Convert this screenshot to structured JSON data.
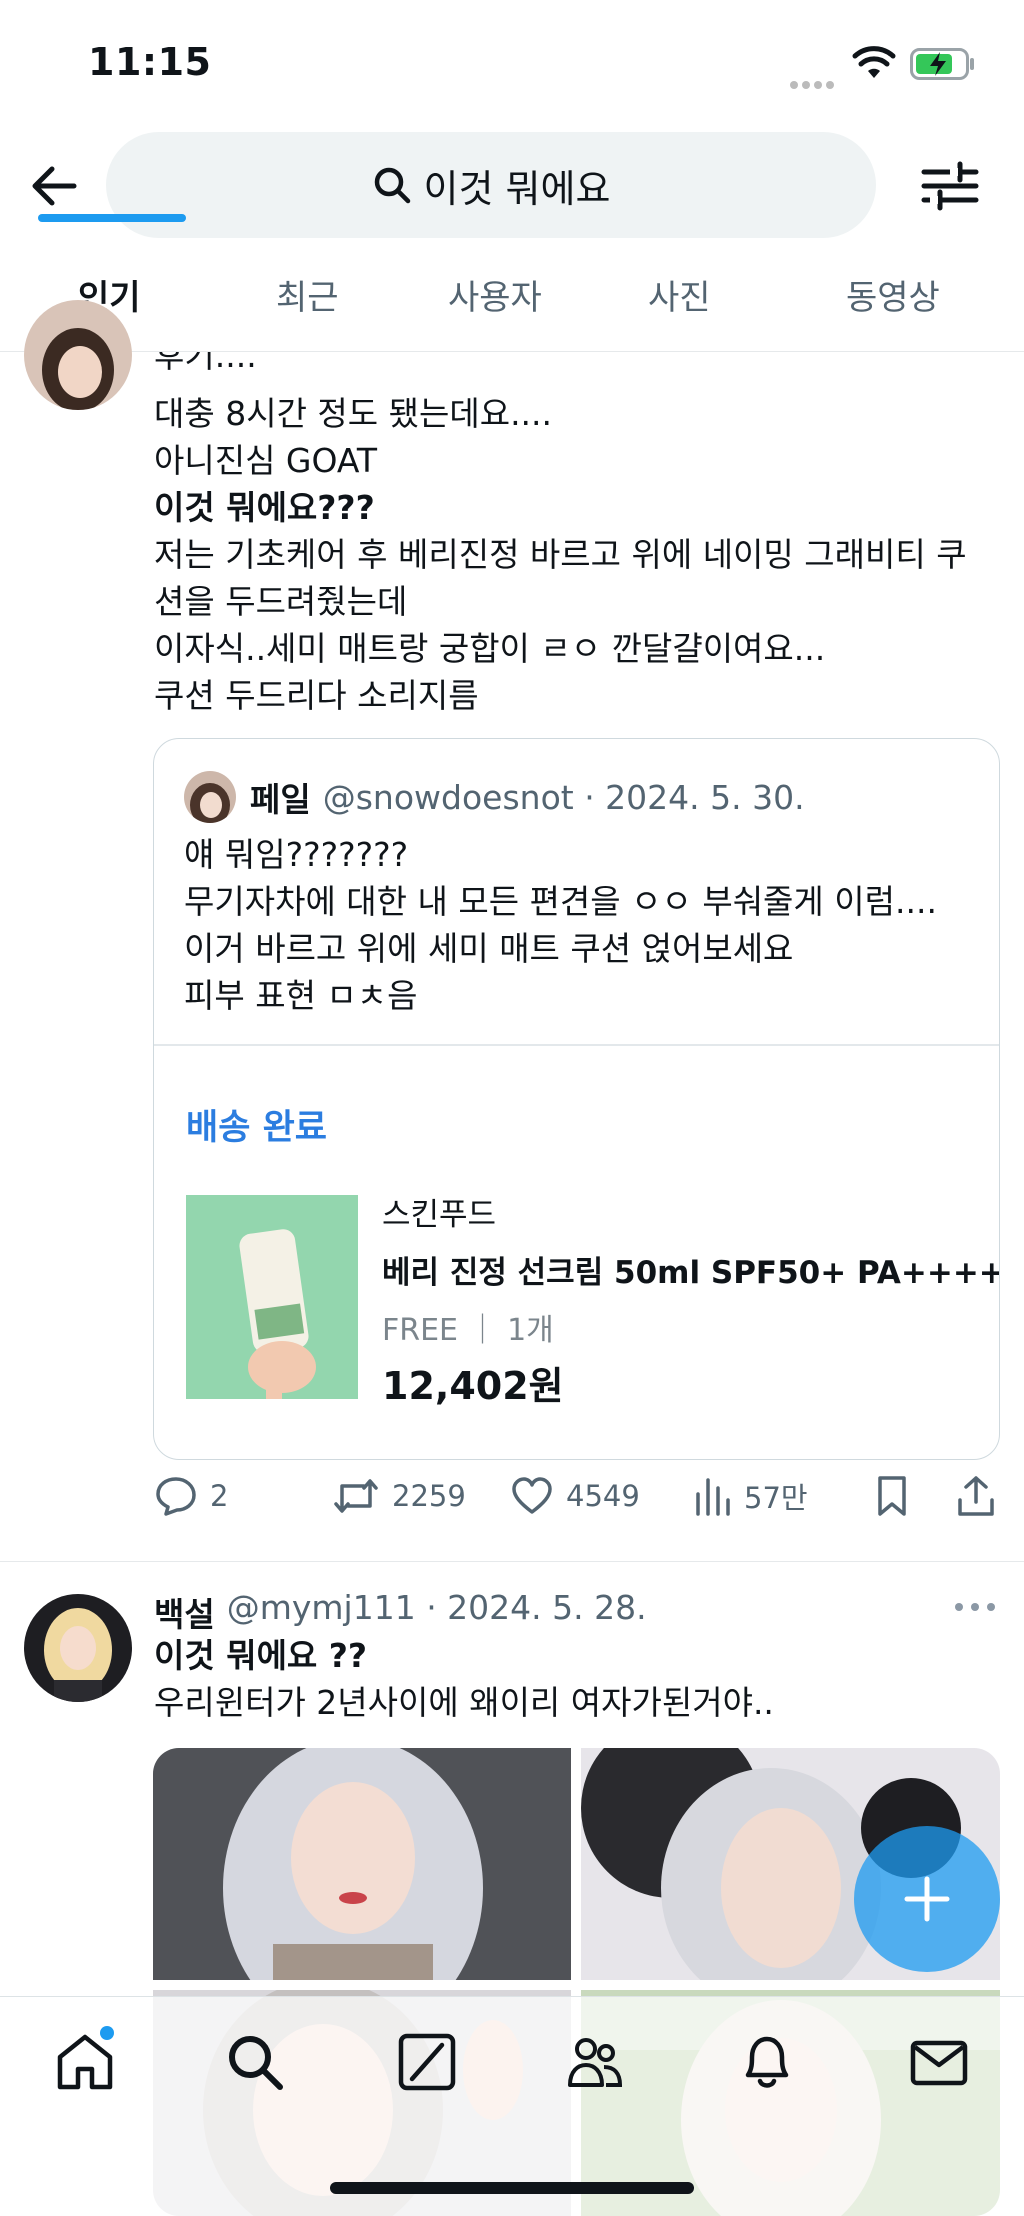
{
  "status_bar": {
    "time": "11:15"
  },
  "search": {
    "query": "이것 뭐에요"
  },
  "tabs": [
    {
      "label": "인기",
      "active": true
    },
    {
      "label": "최근",
      "active": false
    },
    {
      "label": "사용자",
      "active": false
    },
    {
      "label": "사진",
      "active": false
    },
    {
      "label": "동영상",
      "active": false
    }
  ],
  "post1": {
    "lines": [
      "후기....",
      "대충 8시간 정도 됐는데요....",
      "아니진심 GOAT",
      "이것 뭐에요???",
      "저는 기초케어 후 베리진정 바르고 위에 네이밍 그래비티 쿠",
      "션을 두드려줬는데",
      "이자식..세미 매트랑 궁합이 ㄹㅇ 깐달걀이여요...",
      "쿠션 두드리다 소리지름"
    ],
    "quote": {
      "name": "페일",
      "handle_date": "@snowdoesnot · 2024. 5. 30.",
      "lines": [
        "얘 뭐임???????",
        "무기자차에 대한 내 모든 편견을 ㅇㅇ 부숴줄게 이럼....",
        "이거 바르고 위에 세미 매트 쿠션 얹어보세요",
        "피부 표현 ㅁㅊ음"
      ],
      "shipping_status": "배송 완료",
      "product": {
        "brand": "스킨푸드",
        "name": "베리 진정 선크림 50ml SPF50+ PA++++",
        "meta": "FREE ｜ 1개",
        "price": "12,402원"
      }
    },
    "stats": {
      "replies": "2",
      "retweets": "2259",
      "likes": "4549",
      "views": "57만"
    }
  },
  "post2": {
    "name": "백설",
    "handle_date": "@mymj111 · 2024. 5. 28.",
    "lines": [
      "이것 뭐에요 ??",
      "우리윈터가 2년사이에 왜이리 여자가된거야.."
    ]
  },
  "colors": {
    "accent": "#1d9bf0",
    "link_blue": "#2b7de0",
    "text": "#0f1419",
    "secondary": "#536471"
  },
  "icons": [
    "back-arrow-icon",
    "search-icon",
    "filter-icon",
    "reply-icon",
    "retweet-icon",
    "like-icon",
    "views-icon",
    "bookmark-icon",
    "share-icon",
    "more-icon",
    "compose-plus-icon",
    "home-icon",
    "explore-icon",
    "grok-icon",
    "communities-icon",
    "notifications-icon",
    "messages-icon"
  ]
}
